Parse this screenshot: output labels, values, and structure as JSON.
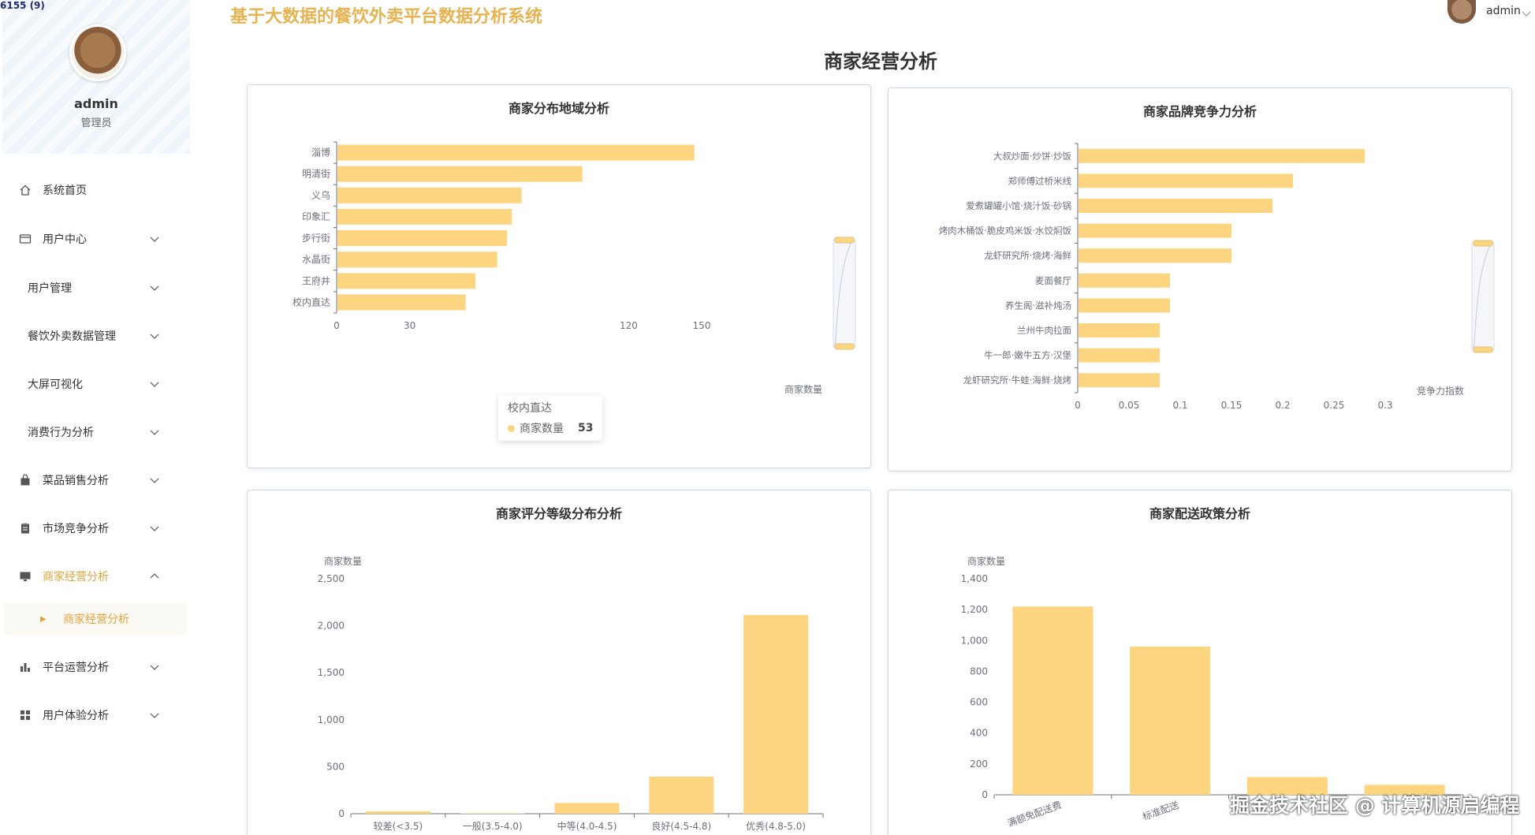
{
  "header": {
    "system_title": "基于大数据的餐饮外卖平台数据分析系统",
    "user_name": "admin",
    "page_title": "商家经营分析"
  },
  "overlay_text": "6155 (9)",
  "profile": {
    "name": "admin",
    "role": "管理员"
  },
  "sidebar": {
    "items": [
      {
        "label": "系统首页",
        "icon": "home-icon"
      },
      {
        "label": "用户中心",
        "icon": "id-card-icon"
      },
      {
        "label": "用户管理"
      },
      {
        "label": "餐饮外卖数据管理"
      },
      {
        "label": "大屏可视化"
      },
      {
        "label": "消费行为分析"
      },
      {
        "label": "菜品销售分析",
        "icon": "bag-icon"
      },
      {
        "label": "市场竞争分析",
        "icon": "clipboard-icon"
      },
      {
        "label": "商家经营分析",
        "icon": "monitor-icon"
      },
      {
        "label": "平台运营分析",
        "icon": "bar-chart-icon"
      },
      {
        "label": "用户体验分析",
        "icon": "grid-icon"
      }
    ],
    "active_sub": "商家经营分析"
  },
  "colors": {
    "accent": "#e6a23c",
    "bar": "#fdd580",
    "title": "#e6b352"
  },
  "watermark": "掘金技术社区 @ 计算机源启编程",
  "cards": [
    {
      "title": "商家分布地域分析"
    },
    {
      "title": "商家品牌竞争力分析"
    },
    {
      "title": "商家评分等级分布分析"
    },
    {
      "title": "商家配送政策分析"
    }
  ],
  "tooltip": {
    "title": "校内直达",
    "series": "商家数量",
    "value": "53"
  },
  "chart_data": [
    {
      "type": "bar",
      "orientation": "horizontal",
      "title": "商家分布地域分析",
      "categories": [
        "淄博",
        "明清街",
        "义乌",
        "印象汇",
        "步行街",
        "水晶街",
        "王府井",
        "校内直达"
      ],
      "series": [
        {
          "name": "商家数量",
          "values": [
            147,
            101,
            76,
            72,
            70,
            66,
            57,
            53
          ]
        }
      ],
      "xlabel": "商家数量",
      "xticks": [
        "0",
        "30",
        "120",
        "150"
      ],
      "xlim": [
        0,
        150
      ],
      "data_zoom": "right"
    },
    {
      "type": "bar",
      "orientation": "horizontal",
      "title": "商家品牌竞争力分析",
      "categories": [
        "大叔炒面·炒饼·炒饭",
        "郑师傅过桥米线",
        "爱煮罐罐小馆·烧汁饭·砂锅",
        "烤肉木桶饭·脆皮鸡米饭·水饺焖饭",
        "龙虾研究所·烧烤·海鲜",
        "麦面餐厅",
        "养生阁·滋补炖汤",
        "兰州牛肉拉面",
        "牛一郎·嫩牛五方·汉堡",
        "龙虾研究所·牛蛙·海鲜·烧烤"
      ],
      "series": [
        {
          "name": "竞争力指数",
          "values": [
            0.28,
            0.21,
            0.19,
            0.15,
            0.15,
            0.09,
            0.09,
            0.08,
            0.08,
            0.08
          ]
        }
      ],
      "xlabel": "竞争力指数",
      "xticks": [
        "0",
        "0.05",
        "0.1",
        "0.15",
        "0.2",
        "0.25",
        "0.3"
      ],
      "xlim": [
        0,
        0.3
      ],
      "data_zoom": "right"
    },
    {
      "type": "bar",
      "title": "商家评分等级分布分析",
      "categories": [
        "较差(<3.5)",
        "一般(3.5-4.0)",
        "中等(4.0-4.5)",
        "良好(4.5-4.8)",
        "优秀(4.8-5.0)"
      ],
      "series": [
        {
          "name": "商家数量",
          "values": [
            25,
            5,
            115,
            395,
            2115
          ]
        }
      ],
      "ylabel": "商家数量",
      "yticks": [
        "0",
        "500",
        "1,000",
        "1,500",
        "2,000",
        "2,500"
      ],
      "ylim": [
        0,
        2500
      ]
    },
    {
      "type": "bar",
      "title": "商家配送政策分析",
      "categories": [
        "满额免配送费",
        "标准配送",
        "",
        ""
      ],
      "series": [
        {
          "name": "商家数量",
          "values": [
            1220,
            960,
            115,
            65
          ]
        }
      ],
      "ylabel": "商家数量",
      "yticks": [
        "0",
        "200",
        "400",
        "600",
        "800",
        "1,000",
        "1,200",
        "1,400"
      ],
      "ylim": [
        0,
        1400
      ]
    }
  ]
}
